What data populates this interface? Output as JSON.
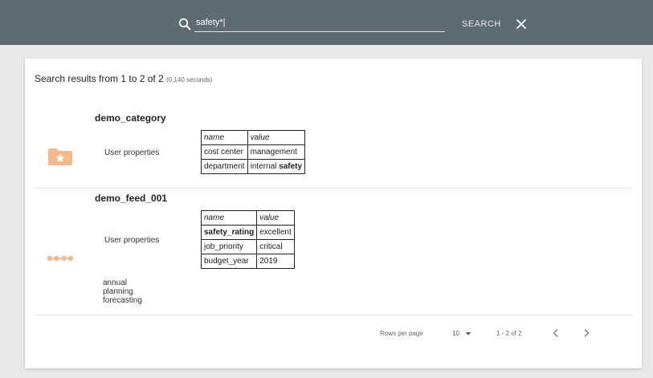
{
  "search": {
    "query": "safety*|",
    "button_label": "SEARCH"
  },
  "results_summary": {
    "text": "Search results from 1 to 2 of 2",
    "time": "(0.140 seconds)"
  },
  "results": [
    {
      "title": "demo_category",
      "props_label": "User properties",
      "headers": [
        "name",
        "value"
      ],
      "rows": [
        {
          "name": "cost center",
          "value": "management",
          "value_plain": "",
          "value_bold": ""
        },
        {
          "name": "department",
          "value_plain": "internal ",
          "value_bold": "safety"
        }
      ],
      "icon": "folder-star-icon",
      "icon_color": "#f3b98c"
    },
    {
      "title": "demo_feed_001",
      "props_label": "User properties",
      "headers": [
        "name",
        "value"
      ],
      "rows": [
        {
          "name_bold": "safety_rating",
          "value": "excellent"
        },
        {
          "name": "job_priority",
          "value": "critical"
        },
        {
          "name": "budget_year",
          "value": "2019"
        }
      ],
      "tags": [
        "annual",
        "planning",
        "forecasting"
      ],
      "icon": "feed-icon",
      "icon_color": "#f3b98c"
    }
  ],
  "pagination": {
    "rows_per_page_label": "Rows per page",
    "rows_per_page_value": "10",
    "range": "1 - 2 of 2"
  },
  "colors": {
    "topbar": "#5f6b72",
    "accent_icon": "#f3b98c"
  }
}
